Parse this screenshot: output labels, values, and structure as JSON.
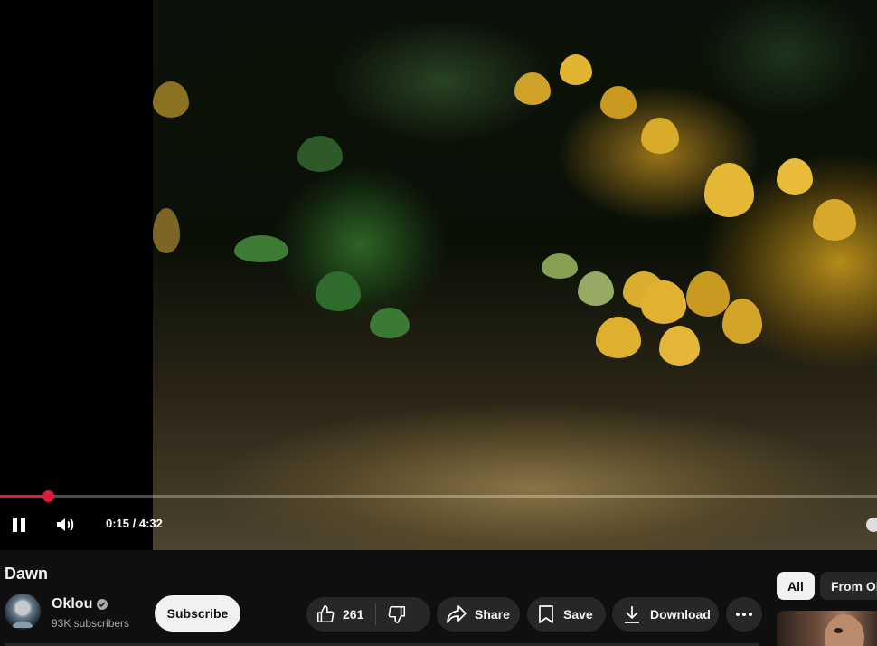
{
  "player": {
    "progress_fraction": 0.055,
    "time_display": "0:15 / 4:32",
    "accent_color": "#e01a3a",
    "icons": {
      "play_pause": "pause-icon",
      "volume": "volume-icon"
    }
  },
  "video": {
    "title": "Dawn"
  },
  "channel": {
    "name": "Oklou",
    "subscribers": "93K subscribers",
    "verified_icon": "verified-icon",
    "subscribe_label": "Subscribe"
  },
  "actions": {
    "like_count": "261",
    "share_label": "Share",
    "save_label": "Save",
    "download_label": "Download",
    "icons": [
      "thumbs-up-icon",
      "thumbs-down-icon",
      "share-icon",
      "save-icon",
      "download-icon",
      "more-icon"
    ]
  },
  "sidebar": {
    "chips": [
      {
        "label": "All",
        "selected": true
      },
      {
        "label": "From Oklou",
        "selected": false
      }
    ]
  }
}
